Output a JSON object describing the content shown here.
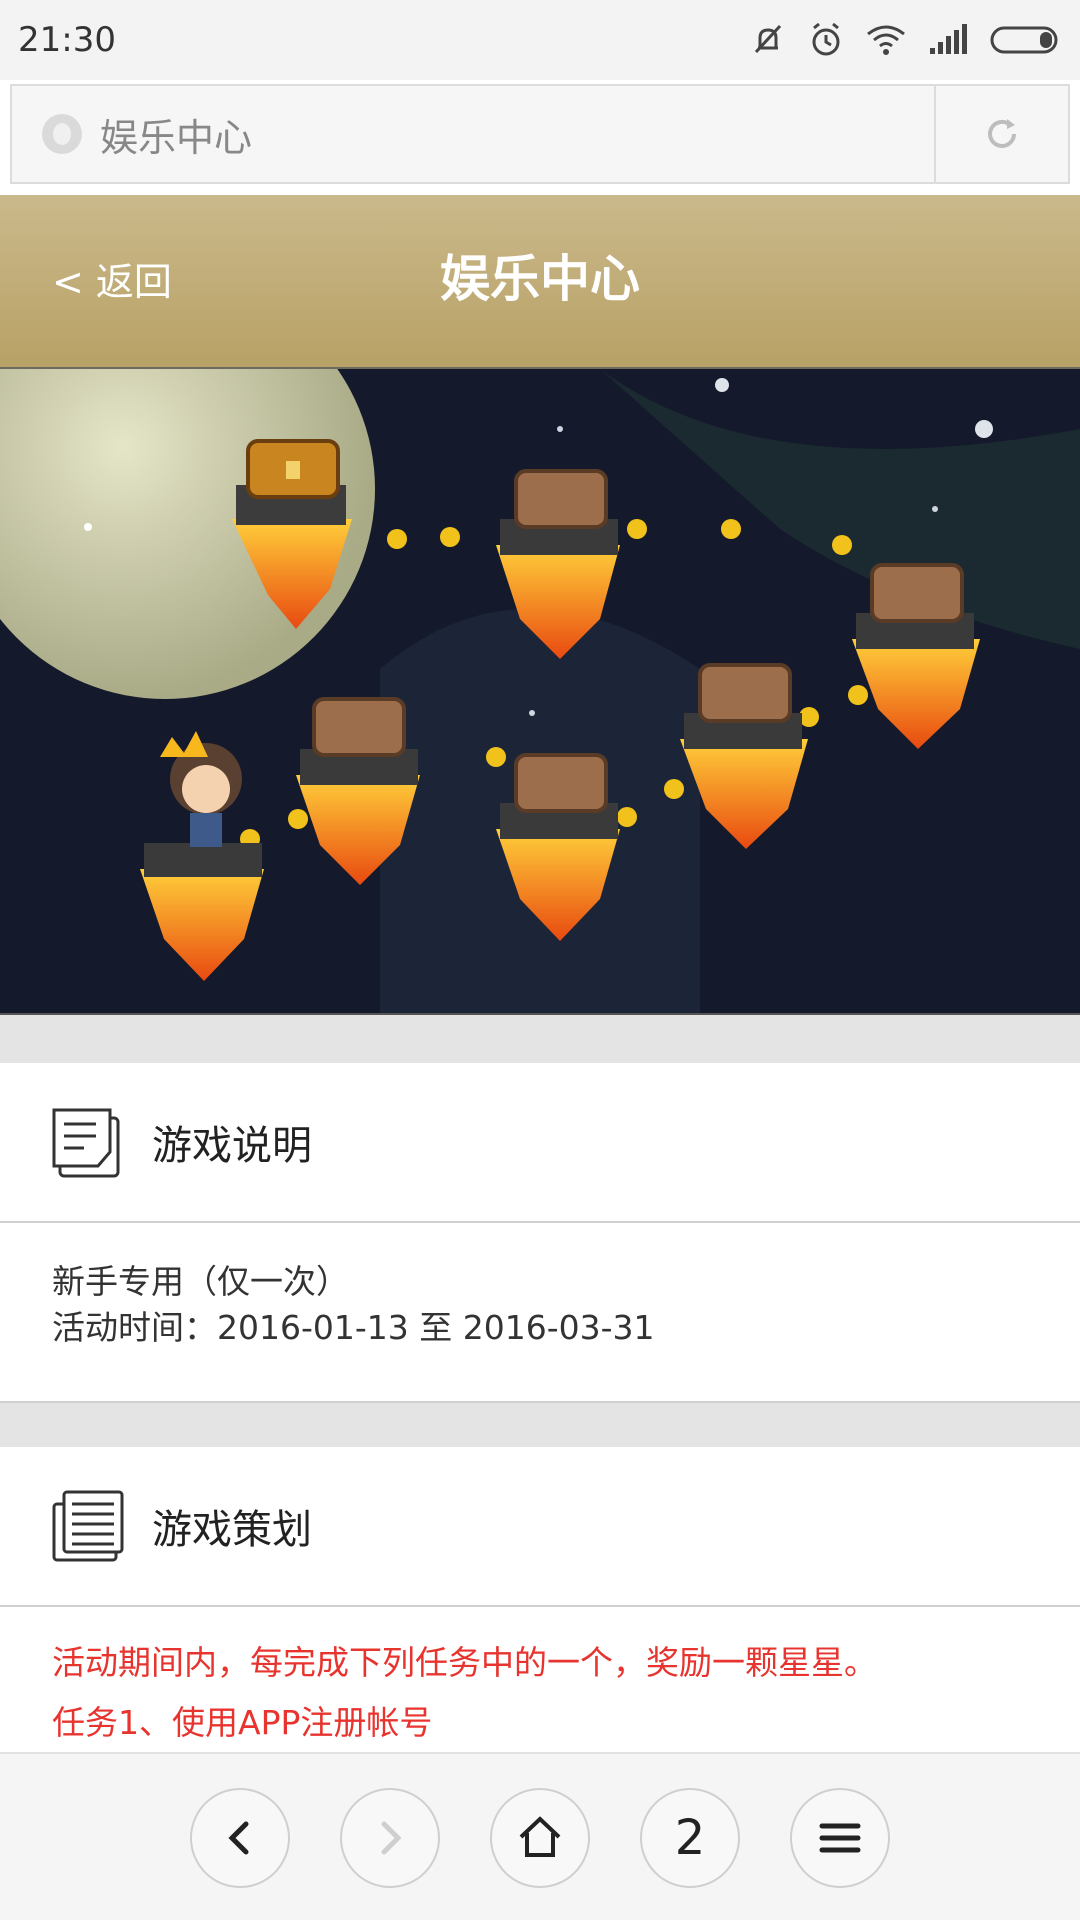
{
  "status_bar": {
    "time": "21:30",
    "icons": [
      "mute-vibrate-icon",
      "alarm-icon",
      "wifi-icon",
      "signal-icon",
      "battery-icon"
    ]
  },
  "browser": {
    "url_text": "娱乐中心"
  },
  "header": {
    "back_label": "< 返回",
    "title": "娱乐中心",
    "bg_color": "#c2ad78"
  },
  "game_info": {
    "title": "游戏说明",
    "line1": "新手专用（仅一次）",
    "line2": "活动时间：2016-01-13 至 2016-03-31"
  },
  "game_plan": {
    "title": "游戏策划",
    "line1": "活动期间内，每完成下列任务中的一个，奖励一颗星星。",
    "line2": "任务1、使用APP注册帐号"
  },
  "bottom_nav": {
    "tab_count": "2"
  },
  "colors": {
    "accent_red": "#e8342f",
    "gold": "#b8a166"
  }
}
